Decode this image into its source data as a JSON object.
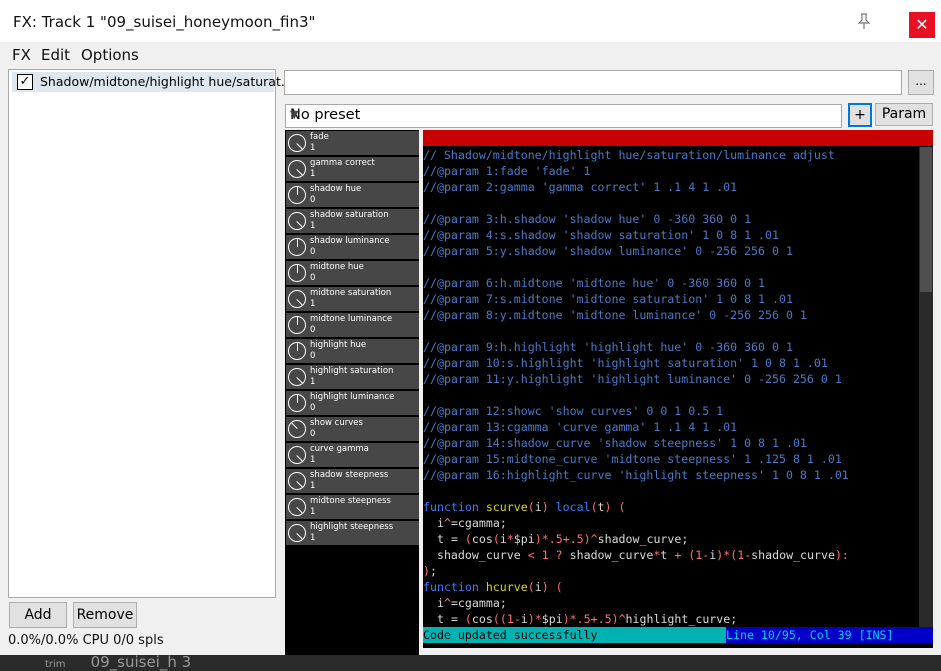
{
  "window": {
    "title": "FX: Track 1 \"09_suisei_honeymoon_fin3\"",
    "close_label": "✕"
  },
  "menus": [
    "FX",
    "Edit",
    "Options"
  ],
  "fx_list": {
    "items": [
      {
        "name": "Shadow/midtone/highlight hue/saturat...",
        "checked": "✓"
      }
    ]
  },
  "buttons": {
    "add": "Add",
    "remove": "Remove",
    "browse": "...",
    "plus": "+",
    "param": "Param"
  },
  "cpu_status": "0.0%/0.0% CPU 0/0 spls",
  "preset": {
    "value": "No preset"
  },
  "sliders": [
    {
      "label": "fade",
      "value": "1"
    },
    {
      "label": "gamma correct",
      "value": "1"
    },
    {
      "label": "shadow hue",
      "value": "0"
    },
    {
      "label": "shadow saturation",
      "value": "1"
    },
    {
      "label": "shadow luminance",
      "value": "0"
    },
    {
      "label": "midtone hue",
      "value": "0"
    },
    {
      "label": "midtone saturation",
      "value": "1"
    },
    {
      "label": "midtone luminance",
      "value": "0"
    },
    {
      "label": "highlight hue",
      "value": "0"
    },
    {
      "label": "highlight saturation",
      "value": "1"
    },
    {
      "label": "highlight luminance",
      "value": "0"
    },
    {
      "label": "show curves",
      "value": "0"
    },
    {
      "label": "curve gamma",
      "value": "1"
    },
    {
      "label": "shadow steepness",
      "value": "1"
    },
    {
      "label": "midtone steepness",
      "value": "1"
    },
    {
      "label": "highlight steepness",
      "value": "1"
    }
  ],
  "code_lines": [
    "// Shadow/midtone/highlight hue/saturation/luminance adjust",
    "//@param 1:fade 'fade' 1",
    "//@param 2:gamma 'gamma correct' 1 .1 4 1 .01",
    "",
    "//@param 3:h.shadow 'shadow hue' 0 -360 360 0 1",
    "//@param 4:s.shadow 'shadow saturation' 1 0 8 1 .01",
    "//@param 5:y.shadow 'shadow luminance' 0 -256 256 0 1",
    "",
    "//@param 6:h.midtone 'midtone hue' 0 -360 360 0 1",
    "//@param 7:s.midtone 'midtone saturation' 1 0 8 1 .01",
    "//@param 8:y.midtone 'midtone luminance' 0 -256 256 0 1",
    "",
    "//@param 9:h.highlight 'highlight hue' 0 -360 360 0 1",
    "//@param 10:s.highlight 'highlight saturation' 1 0 8 1 .01",
    "//@param 11:y.highlight 'highlight luminance' 0 -256 256 0 1",
    "",
    "//@param 12:showc 'show curves' 0 0 1 0.5 1",
    "//@param 13:cgamma 'curve gamma' 1 .1 4 1 .01",
    "//@param 14:shadow_curve 'shadow steepness' 1 0 8 1 .01",
    "//@param 15:midtone_curve 'midtone steepness' 1 .125 8 1 .01",
    "//@param 16:highlight_curve 'highlight steepness' 1 0 8 1 .01",
    "",
    "function scurve(i) local(t) (",
    "  i^=cgamma;",
    "  t = (cos(i*$pi)*.5+.5)^shadow_curve;",
    "  shadow_curve < 1 ? shadow_curve*t + (1-i)*(1-shadow_curve):",
    ");",
    "function hcurve(i) (",
    "  i^=cgamma;",
    "  t = (cos((1-i)*$pi)*.5+.5)^highlight_curve;"
  ],
  "editor_status": {
    "message": "Code updated successfully",
    "position": "Line 10/95, Col 39 [INS]"
  },
  "background_text": {
    "left": "trim",
    "right": "09_suisei_h 3"
  },
  "colors": {
    "comment": "#4a7ac8",
    "keyword": "#3a7cff",
    "funcname": "#d8d800",
    "number": "#ff7070",
    "default": "#d8d8d8",
    "redbar": "#c80000"
  }
}
